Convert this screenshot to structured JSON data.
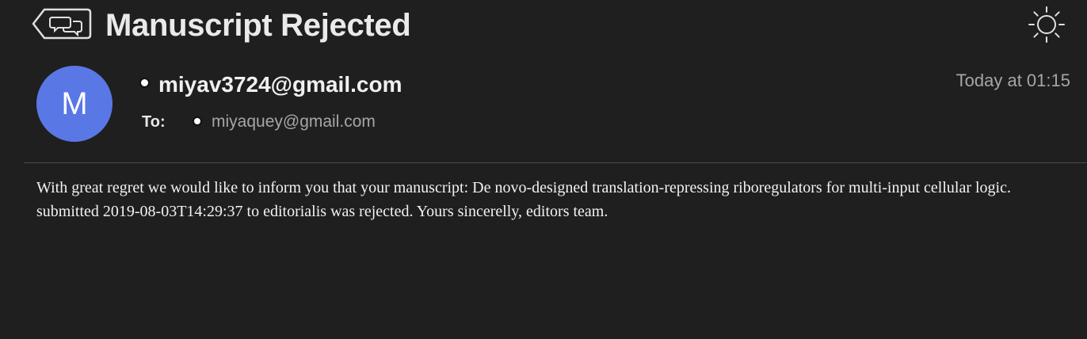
{
  "header": {
    "title": "Manuscript Rejected",
    "back_icon": "back-messages-icon",
    "theme_icon": "sun-icon"
  },
  "message": {
    "avatar_initial": "M",
    "avatar_color": "#5a77e6",
    "sender": "miyav3724@gmail.com",
    "timestamp": "Today at 01:15",
    "to_label": "To:",
    "recipient": "miyaquey@gmail.com",
    "body": "With great regret we would like to inform you that your manuscript: De novo-designed translation-repressing riboregulators for multi-input cellular logic. submitted 2019-08-03T14:29:37 to editorialis was rejected. Yours sincerelly, editors team."
  },
  "colors": {
    "background": "#1f1f1f",
    "divider": "#4a4a4a",
    "secondary_text": "#a6a6a6"
  }
}
